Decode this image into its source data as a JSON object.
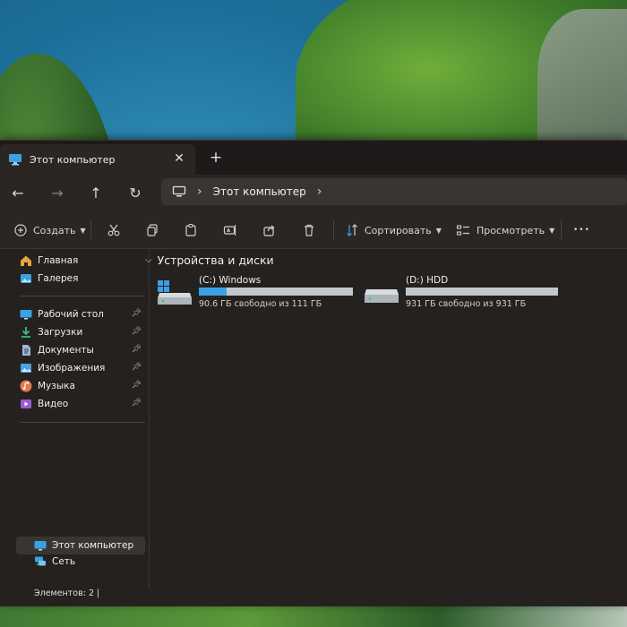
{
  "window": {
    "tab_title": "Этот компьютер",
    "close_glyph": "✕",
    "new_tab_glyph": "+"
  },
  "nav": {
    "back_glyph": "←",
    "forward_glyph": "→",
    "up_glyph": "↑",
    "refresh_glyph": "↻",
    "separator_glyph": "›",
    "address_text": "Этот компьютер"
  },
  "toolbar": {
    "create_label": "Создать",
    "sort_label": "Сортировать",
    "view_label": "Просмотреть",
    "more_glyph": "•••"
  },
  "sidebar": {
    "top": [
      {
        "label": "Главная",
        "icon": "home-icon",
        "color": "#e8a43a"
      },
      {
        "label": "Галерея",
        "icon": "gallery-icon",
        "color": "#3aa2e4"
      }
    ],
    "quick": [
      {
        "label": "Рабочий стол",
        "icon": "desktop-icon",
        "color": "#3aa2e4"
      },
      {
        "label": "Загрузки",
        "icon": "downloads-icon",
        "color": "#35c27a"
      },
      {
        "label": "Документы",
        "icon": "documents-icon",
        "color": "#9fb7d6"
      },
      {
        "label": "Изображения",
        "icon": "pictures-icon",
        "color": "#4fa3e0"
      },
      {
        "label": "Музыка",
        "icon": "music-icon",
        "color": "#e07a4f"
      },
      {
        "label": "Видео",
        "icon": "videos-icon",
        "color": "#9b59d6"
      }
    ],
    "this_pc": "Этот компьютер",
    "network": "Сеть"
  },
  "content": {
    "group_title": "Устройства и диски",
    "drives": [
      {
        "name": "(C:) Windows",
        "free_text": "90.6 ГБ свободно из 111 ГБ",
        "used_fraction": 0.18
      },
      {
        "name": "(D:) HDD",
        "free_text": "931 ГБ свободно из 931 ГБ",
        "used_fraction": 0.0
      }
    ]
  },
  "status": {
    "items_text": "Элементов: 2  |"
  },
  "colors": {
    "accent": "#3aa2e4",
    "window_bg": "#25211f",
    "panel_bg": "#2b2624"
  }
}
